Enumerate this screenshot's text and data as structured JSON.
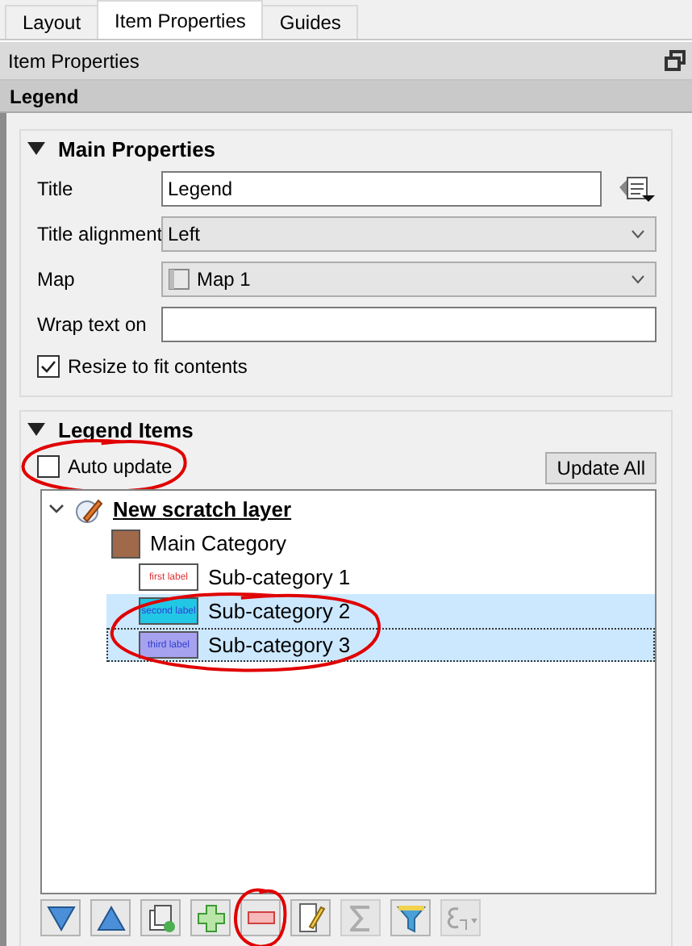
{
  "tabs": [
    {
      "label": "Layout",
      "selected": false
    },
    {
      "label": "Item Properties",
      "selected": true
    },
    {
      "label": "Guides",
      "selected": false
    }
  ],
  "dock_title": "Item Properties",
  "item_header": "Legend",
  "main_properties": {
    "title": "Main Properties",
    "expanded": true,
    "fields": [
      {
        "kind": "text",
        "label": "Title",
        "value": "Legend",
        "has_expression_button": true
      },
      {
        "kind": "combo",
        "label": "Title alignment",
        "value": "Left"
      },
      {
        "kind": "combo",
        "label": "Map",
        "value": "Map 1",
        "has_map_icon": true
      },
      {
        "kind": "text",
        "label": "Wrap text on"
      }
    ],
    "resize": {
      "label": "Resize to fit contents",
      "checked": true
    }
  },
  "legend_items": {
    "title": "Legend Items",
    "expanded": true,
    "auto_update": {
      "label": "Auto update",
      "checked": false,
      "circled": true
    },
    "update_all": "Update All",
    "tree": [
      {
        "label": "New scratch layer",
        "kind": "layer",
        "expanded": true,
        "selected": false,
        "children": [
          {
            "label": "Main Category",
            "kind": "fill",
            "color": "#a0694a",
            "selected": false,
            "children": [
              {
                "label": "Sub-category 1",
                "kind": "label",
                "swatch_text": "first label",
                "color": "#ffffff",
                "selected": false,
                "circled": false
              },
              {
                "label": "Sub-category 2",
                "kind": "label",
                "swatch_text": "second label",
                "color": "#22c7e6",
                "selected": true,
                "circled": true
              },
              {
                "label": "Sub-category 3",
                "kind": "label",
                "swatch_text": "third label",
                "color": "#a7a2f0",
                "selected": true,
                "focused": true,
                "circled": true
              }
            ]
          }
        ]
      }
    ],
    "toolbar": [
      {
        "kind": "move-down",
        "disabled": false,
        "circled": false
      },
      {
        "kind": "move-up",
        "disabled": false,
        "circled": false
      },
      {
        "kind": "add-group",
        "disabled": false,
        "circled": false
      },
      {
        "kind": "add",
        "disabled": false,
        "circled": false
      },
      {
        "kind": "remove",
        "disabled": false,
        "circled": true
      },
      {
        "kind": "edit",
        "disabled": false,
        "circled": false
      },
      {
        "kind": "sum",
        "disabled": true,
        "circled": false
      },
      {
        "kind": "filter",
        "disabled": false,
        "circled": false
      },
      {
        "kind": "expression",
        "disabled": true,
        "circled": false
      }
    ]
  }
}
